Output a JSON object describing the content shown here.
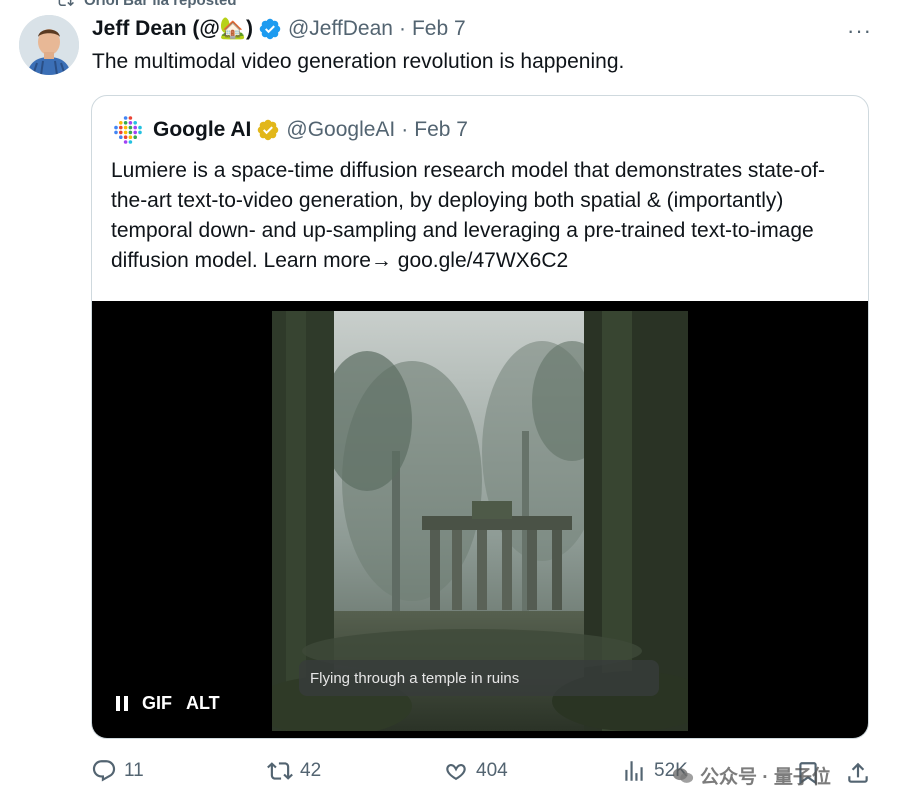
{
  "repost": {
    "text": "Oriol Bar ila reposted"
  },
  "tweet": {
    "author_name": "Jeff Dean (@🏡)",
    "handle": "@JeffDean",
    "separator": "·",
    "date": "Feb 7",
    "text": "The multimodal video generation revolution is happening.",
    "more": "···"
  },
  "quote": {
    "author_name": "Google AI",
    "handle": "@GoogleAI",
    "separator": "·",
    "date": "Feb 7",
    "text": "Lumiere is a space-time diffusion research model that demonstrates state-of-the-art text-to-video generation, by deploying both spatial & (importantly) temporal down- and up-sampling and leveraging a pre-trained text-to-image diffusion model. Learn more→ goo.gle/47WX6C2"
  },
  "video": {
    "caption": "Flying through a temple in ruins",
    "gif_label": "GIF",
    "alt_label": "ALT"
  },
  "actions": {
    "replies": "11",
    "reposts": "42",
    "likes": "404",
    "views": "52K"
  },
  "watermark": {
    "text": "公众号 · 量子位"
  },
  "colors": {
    "verified_blue": "#1d9bf0",
    "verified_gold": "#e2b719",
    "secondary_text": "#536471",
    "border": "#cfd9de"
  }
}
